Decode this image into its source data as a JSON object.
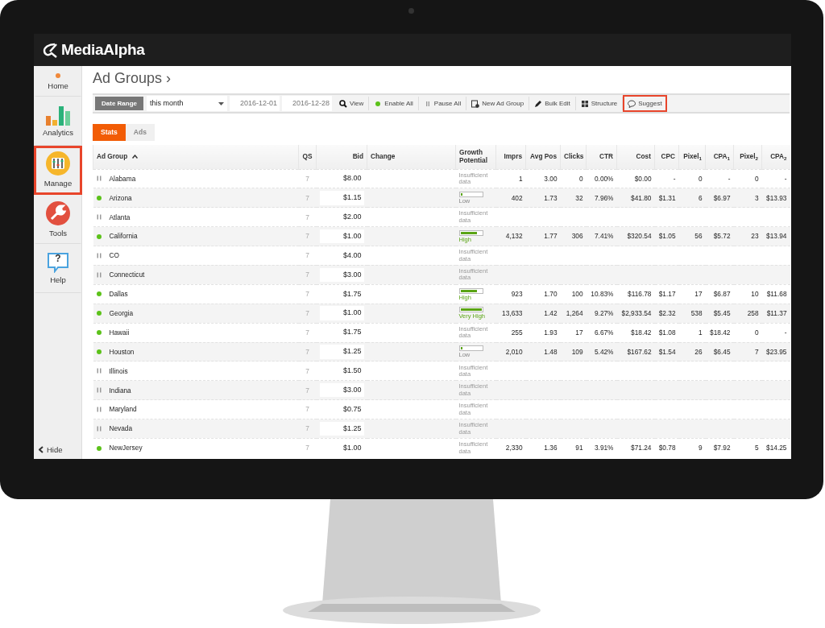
{
  "app": {
    "logo": "MediaAlpha"
  },
  "sidebar": {
    "items": [
      {
        "label": "Home",
        "highlighted": false
      },
      {
        "label": "Analytics",
        "highlighted": false
      },
      {
        "label": "Manage",
        "highlighted": true
      },
      {
        "label": "Tools",
        "highlighted": false
      },
      {
        "label": "Help",
        "icon_text": "?",
        "highlighted": false
      }
    ],
    "hide": "Hide"
  },
  "page": {
    "title": "Ad Groups ›"
  },
  "toolbar": {
    "date_range": "Date Range",
    "period": "this month",
    "start": "2016-12-01",
    "end": "2016-12-28",
    "actions": [
      {
        "label": "View",
        "highlighted": false
      },
      {
        "label": "Enable All",
        "highlighted": false
      },
      {
        "label": "Pause All",
        "highlighted": false
      },
      {
        "label": "New Ad Group",
        "highlighted": false
      },
      {
        "label": "Bulk Edit",
        "highlighted": false
      },
      {
        "label": "Structure",
        "highlighted": false
      },
      {
        "label": "Suggest",
        "highlighted": true
      }
    ]
  },
  "tabs": [
    {
      "label": "Stats",
      "selected": true
    },
    {
      "label": "Ads",
      "selected": false
    }
  ],
  "table": {
    "columns": [
      "Ad Group",
      "QS",
      "Bid",
      "Change",
      "Growth Potential",
      "Imprs",
      "Avg Pos",
      "Clicks",
      "CTR",
      "Cost",
      "CPC",
      "Pixel$_{1}$",
      "CPA$_{1}$",
      "Pixel$_{2}$",
      "CPA$_{2}$"
    ],
    "rows": [
      {
        "name": "Alabama",
        "active": false,
        "qs": "7",
        "bid": "$8.00",
        "growth": {
          "kind": "insufficient",
          "label": "Insufficient data"
        },
        "stats": [
          "1",
          "3.00",
          "0",
          "0.00%",
          "$0.00",
          "-",
          "0",
          "-",
          "0",
          "-"
        ]
      },
      {
        "name": "Arizona",
        "active": true,
        "qs": "7",
        "bid": "$1.15",
        "growth": {
          "kind": "meter",
          "level": 0.1,
          "label": "Low"
        },
        "stats": [
          "402",
          "1.73",
          "32",
          "7.96%",
          "$41.80",
          "$1.31",
          "6",
          "$6.97",
          "3",
          "$13.93"
        ]
      },
      {
        "name": "Atlanta",
        "active": false,
        "qs": "7",
        "bid": "$2.00",
        "growth": {
          "kind": "insufficient",
          "label": "Insufficient data"
        }
      },
      {
        "name": "California",
        "active": true,
        "qs": "7",
        "bid": "$1.00",
        "growth": {
          "kind": "meter",
          "level": 0.8,
          "label": "High"
        },
        "stats": [
          "4,132",
          "1.77",
          "306",
          "7.41%",
          "$320.54",
          "$1.05",
          "56",
          "$5.72",
          "23",
          "$13.94"
        ]
      },
      {
        "name": "CO",
        "active": false,
        "qs": "7",
        "bid": "$4.00",
        "growth": {
          "kind": "insufficient",
          "label": "Insufficient data"
        }
      },
      {
        "name": "Connecticut",
        "active": false,
        "qs": "7",
        "bid": "$3.00",
        "growth": {
          "kind": "insufficient",
          "label": "Insufficient data"
        }
      },
      {
        "name": "Dallas",
        "active": true,
        "qs": "7",
        "bid": "$1.75",
        "growth": {
          "kind": "meter",
          "level": 0.8,
          "label": "High"
        },
        "stats": [
          "923",
          "1.70",
          "100",
          "10.83%",
          "$116.78",
          "$1.17",
          "17",
          "$6.87",
          "10",
          "$11.68"
        ]
      },
      {
        "name": "Georgia",
        "active": true,
        "qs": "7",
        "bid": "$1.00",
        "growth": {
          "kind": "meter",
          "level": 1,
          "label": "Very High"
        },
        "stats": [
          "13,633",
          "1.42",
          "1,264",
          "9.27%",
          "$2,933.54",
          "$2.32",
          "538",
          "$5.45",
          "258",
          "$11.37"
        ]
      },
      {
        "name": "Hawaii",
        "active": true,
        "qs": "7",
        "bid": "$1.75",
        "growth": {
          "kind": "insufficient",
          "label": "Insufficient data"
        },
        "stats": [
          "255",
          "1.93",
          "17",
          "6.67%",
          "$18.42",
          "$1.08",
          "1",
          "$18.42",
          "0",
          "-"
        ]
      },
      {
        "name": "Houston",
        "active": true,
        "qs": "7",
        "bid": "$1.25",
        "growth": {
          "kind": "meter",
          "level": 0.1,
          "label": "Low"
        },
        "stats": [
          "2,010",
          "1.48",
          "109",
          "5.42%",
          "$167.62",
          "$1.54",
          "26",
          "$6.45",
          "7",
          "$23.95"
        ]
      },
      {
        "name": "Illinois",
        "active": false,
        "qs": "7",
        "bid": "$1.50",
        "growth": {
          "kind": "insufficient",
          "label": "Insufficient data"
        }
      },
      {
        "name": "Indiana",
        "active": false,
        "qs": "7",
        "bid": "$3.00",
        "growth": {
          "kind": "insufficient",
          "label": "Insufficient data"
        }
      },
      {
        "name": "Maryland",
        "active": false,
        "qs": "7",
        "bid": "$0.75",
        "growth": {
          "kind": "insufficient",
          "label": "Insufficient data"
        }
      },
      {
        "name": "Nevada",
        "active": false,
        "qs": "7",
        "bid": "$1.25",
        "growth": {
          "kind": "insufficient",
          "label": "Insufficient data"
        }
      },
      {
        "name": "NewJersey",
        "active": true,
        "qs": "7",
        "bid": "$1.00",
        "growth": {
          "kind": "insufficient",
          "label": "Insufficient data"
        },
        "stats": [
          "2,330",
          "1.36",
          "91",
          "3.91%",
          "$71.24",
          "$0.78",
          "9",
          "$7.92",
          "5",
          "$14.25"
        ]
      }
    ]
  }
}
